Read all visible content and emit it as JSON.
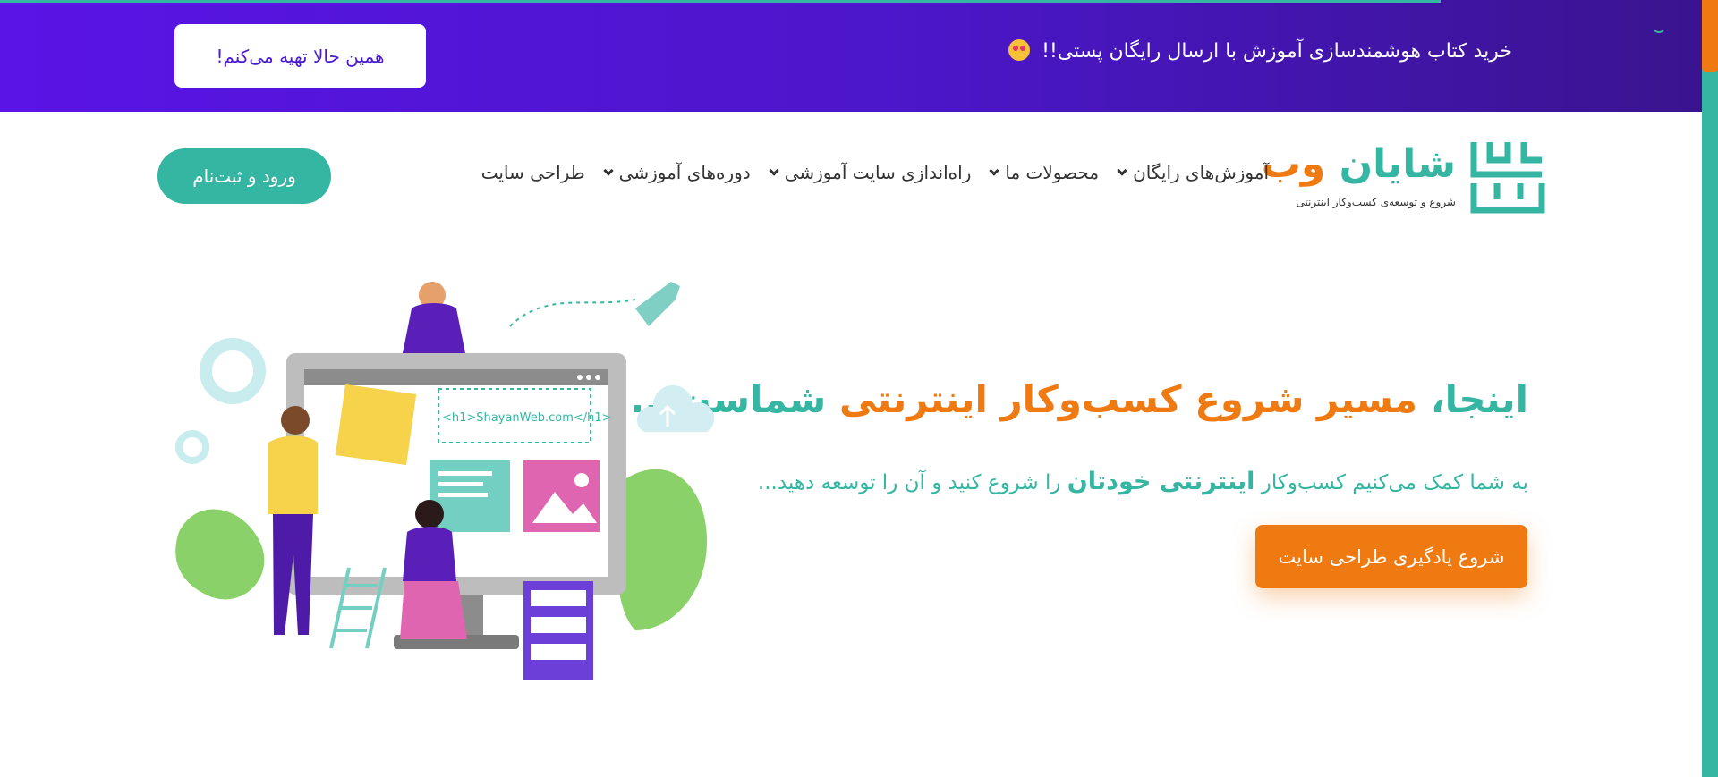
{
  "promo": {
    "text": "خرید کتاب هوشمندسازی آموزش با ارسال رایگان پستی!!",
    "button_label": "همین حالا تهیه می‌کنم!"
  },
  "header": {
    "logo_title_part1": "شایان",
    "logo_title_part2": "وب",
    "logo_subtitle": "شروع و توسعه‌ی کسب‌وکار اینترنتی",
    "nav": [
      {
        "label": "آموزش‌های رایگان",
        "has_dropdown": true
      },
      {
        "label": "محصولات ما",
        "has_dropdown": true
      },
      {
        "label": "راه‌اندازی سایت آموزشی",
        "has_dropdown": true
      },
      {
        "label": "دوره‌های آموزشی",
        "has_dropdown": true
      },
      {
        "label": "طراحی سایت",
        "has_dropdown": false
      }
    ],
    "login_label": "ورود و ثبت‌نام"
  },
  "hero": {
    "title_part1": "اینجا،",
    "title_part2": "مسیر شروع کسب‌وکار اینترنتی",
    "title_part3": "شماست...",
    "subtitle_part1": "به شما کمک می‌کنیم کسب‌وکار",
    "subtitle_bold": "اینترنتی خودتان",
    "subtitle_part2": "را شروع کنید و آن را توسعه دهید...",
    "cta_label": "شروع یادگیری طراحی سایت",
    "illustration_text": "<h1>ShayanWeb.com</h1>"
  },
  "colors": {
    "brand_teal": "#35b6a3",
    "brand_orange": "#ef7a11",
    "promo_purple": "#5a14e6"
  }
}
